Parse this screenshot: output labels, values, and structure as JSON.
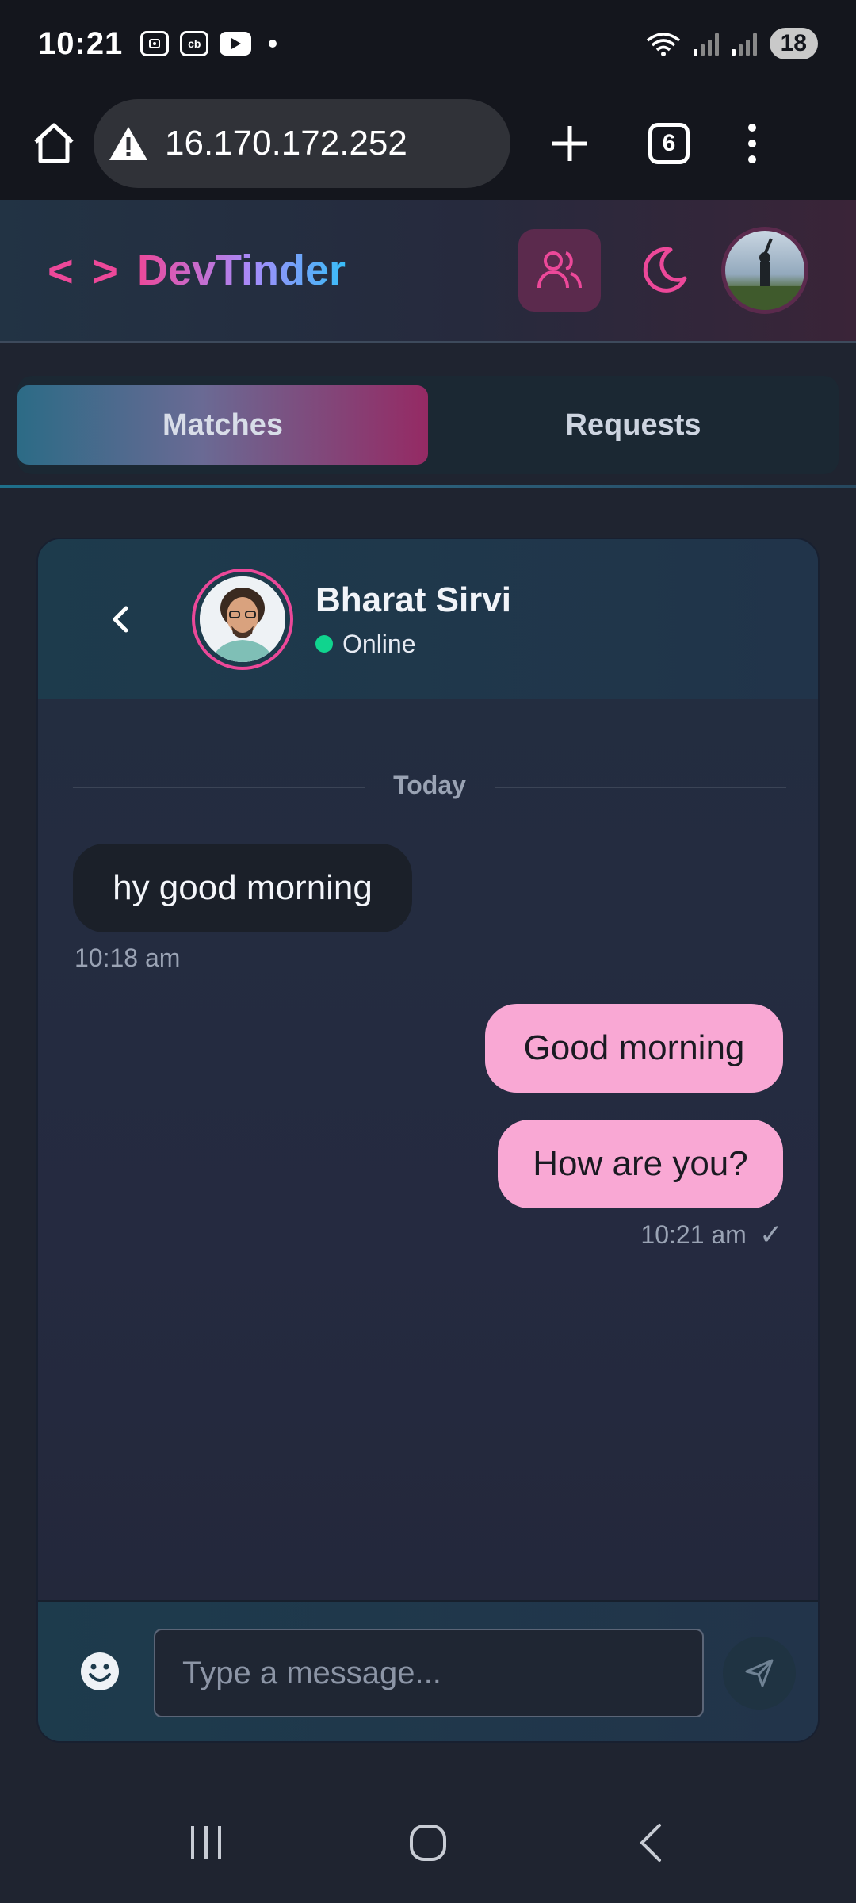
{
  "status_bar": {
    "time": "10:21",
    "app_icons": [
      "screenshot-icon",
      "cb-icon",
      "youtube-icon"
    ],
    "cb_label": "cb",
    "battery": "18"
  },
  "browser": {
    "url": "16.170.172.252",
    "tab_count": "6"
  },
  "header": {
    "logo_code": "< >",
    "app_name": "DevTinder"
  },
  "tabs": {
    "matches": "Matches",
    "requests": "Requests"
  },
  "chat": {
    "contact_name": "Bharat Sirvi",
    "status": "Online",
    "date_separator": "Today",
    "messages": [
      {
        "from": "contact",
        "text": "hy good morning",
        "time": "10:18 am"
      },
      {
        "from": "me",
        "text": "Good morning"
      },
      {
        "from": "me",
        "text": "How are you?",
        "time": "10:21 am",
        "read_mark": "✓"
      }
    ],
    "input_placeholder": "Type a message..."
  },
  "colors": {
    "accent_pink": "#ec4899",
    "bubble_out": "#f9a8d4",
    "online": "#10d48e"
  }
}
